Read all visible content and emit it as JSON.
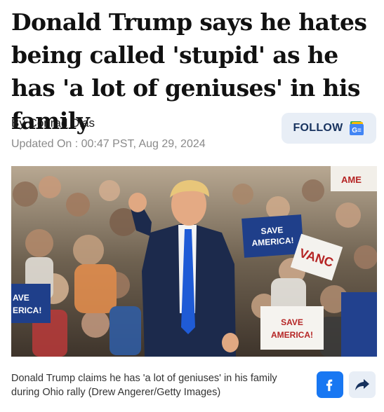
{
  "article": {
    "headline": "Donald Trump says he hates being called 'stupid' as he has 'a lot of geniuses' in his family",
    "byline": "By Conrad Dias",
    "updated": "Updated On : 00:47 PST, Aug 29, 2024",
    "follow_label": "FOLLOW",
    "caption": "Donald Trump claims he has 'a lot of geniuses' in his family during Ohio rally (Drew Angerer/Getty Images)"
  },
  "image": {
    "signs": {
      "sign_1_line1": "SAVE",
      "sign_1_line2": "AMERICA!",
      "sign_2_line1": "SAVE",
      "sign_2_line2": "AMERICA!",
      "sign_3_line1": "AVE",
      "sign_3_line2": "ERICA!",
      "sign_4": "VANC",
      "sign_5": "AME"
    }
  },
  "icons": {
    "follow": "google-news-icon",
    "facebook": "facebook-icon",
    "share": "share-arrow-icon"
  },
  "colors": {
    "follow_bg": "#e8eef6",
    "follow_text": "#17325e",
    "facebook_blue": "#1877f2",
    "share_bg": "#e8eef6",
    "share_arrow": "#17325e"
  }
}
